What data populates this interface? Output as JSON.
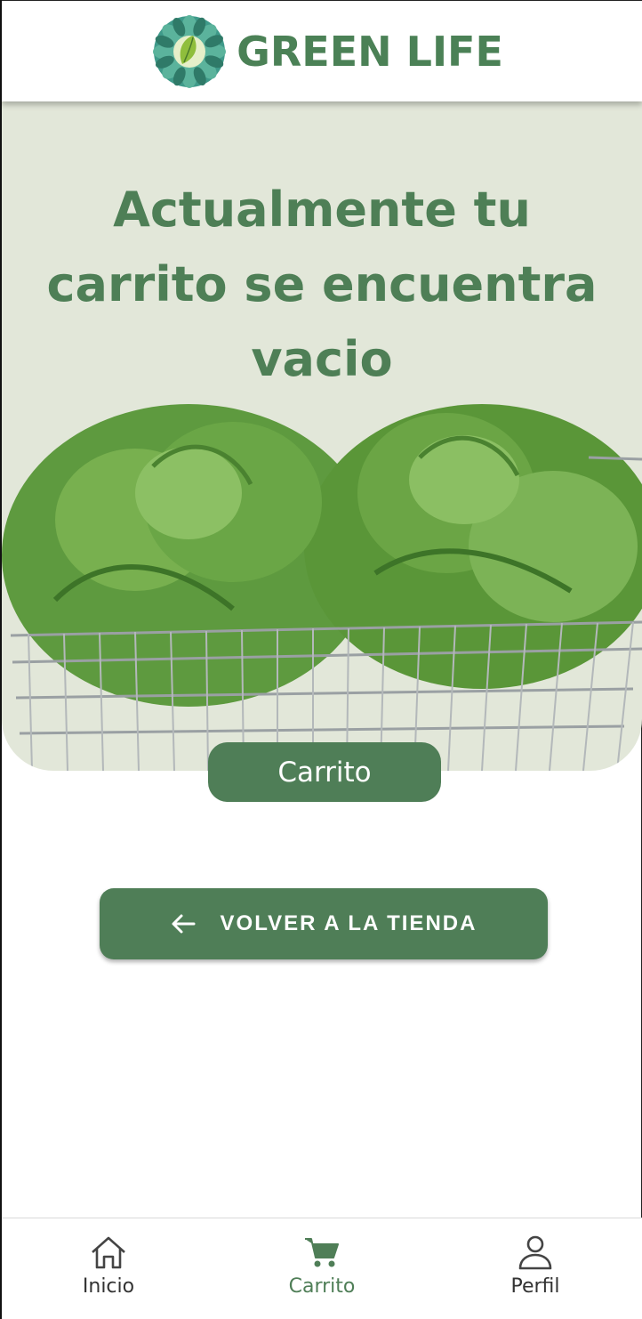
{
  "app": {
    "brand": "GREEN LIFE"
  },
  "colors": {
    "primary": "#4f7e57",
    "hero_bg": "#e2e7d9",
    "title": "#4e7f56"
  },
  "hero": {
    "title": "Actualmente tu carrito se encuentra vacio",
    "image": "lettuce-in-shopping-cart"
  },
  "section_label": "Carrito",
  "actions": {
    "back_label": "VOLVER A LA TIENDA",
    "back_icon": "arrow-left-icon"
  },
  "bottom_nav": {
    "items": [
      {
        "label": "Inicio",
        "icon": "home-icon",
        "active": false
      },
      {
        "label": "Carrito",
        "icon": "cart-icon",
        "active": true
      },
      {
        "label": "Perfil",
        "icon": "user-icon",
        "active": false
      }
    ]
  }
}
